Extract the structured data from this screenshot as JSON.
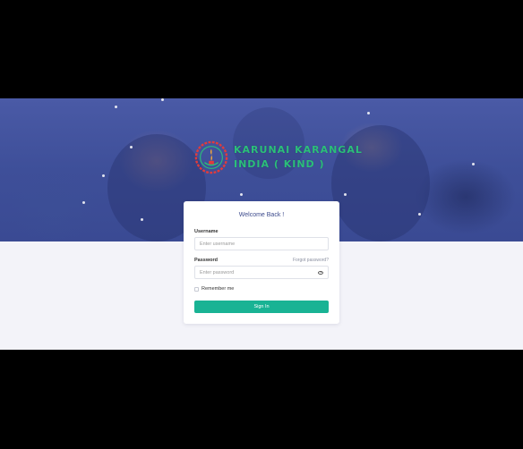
{
  "brand": {
    "line1": "KARUNAI KARANGAL",
    "line2": "INDIA ( KIND )"
  },
  "login": {
    "title": "Welcome Back !",
    "username_label": "Username",
    "username_placeholder": "Enter username",
    "password_label": "Password",
    "password_placeholder": "Enter password",
    "forgot_label": "Forgot password?",
    "remember_label": "Remember me",
    "submit_label": "Sign In"
  },
  "colors": {
    "hero": "#3e4f99",
    "brand_text": "#2bbf7a",
    "primary_button": "#19b394",
    "background": "#f3f3f9"
  },
  "icons": [
    "logo-emblem-icon",
    "eye-icon",
    "checkbox-icon"
  ]
}
